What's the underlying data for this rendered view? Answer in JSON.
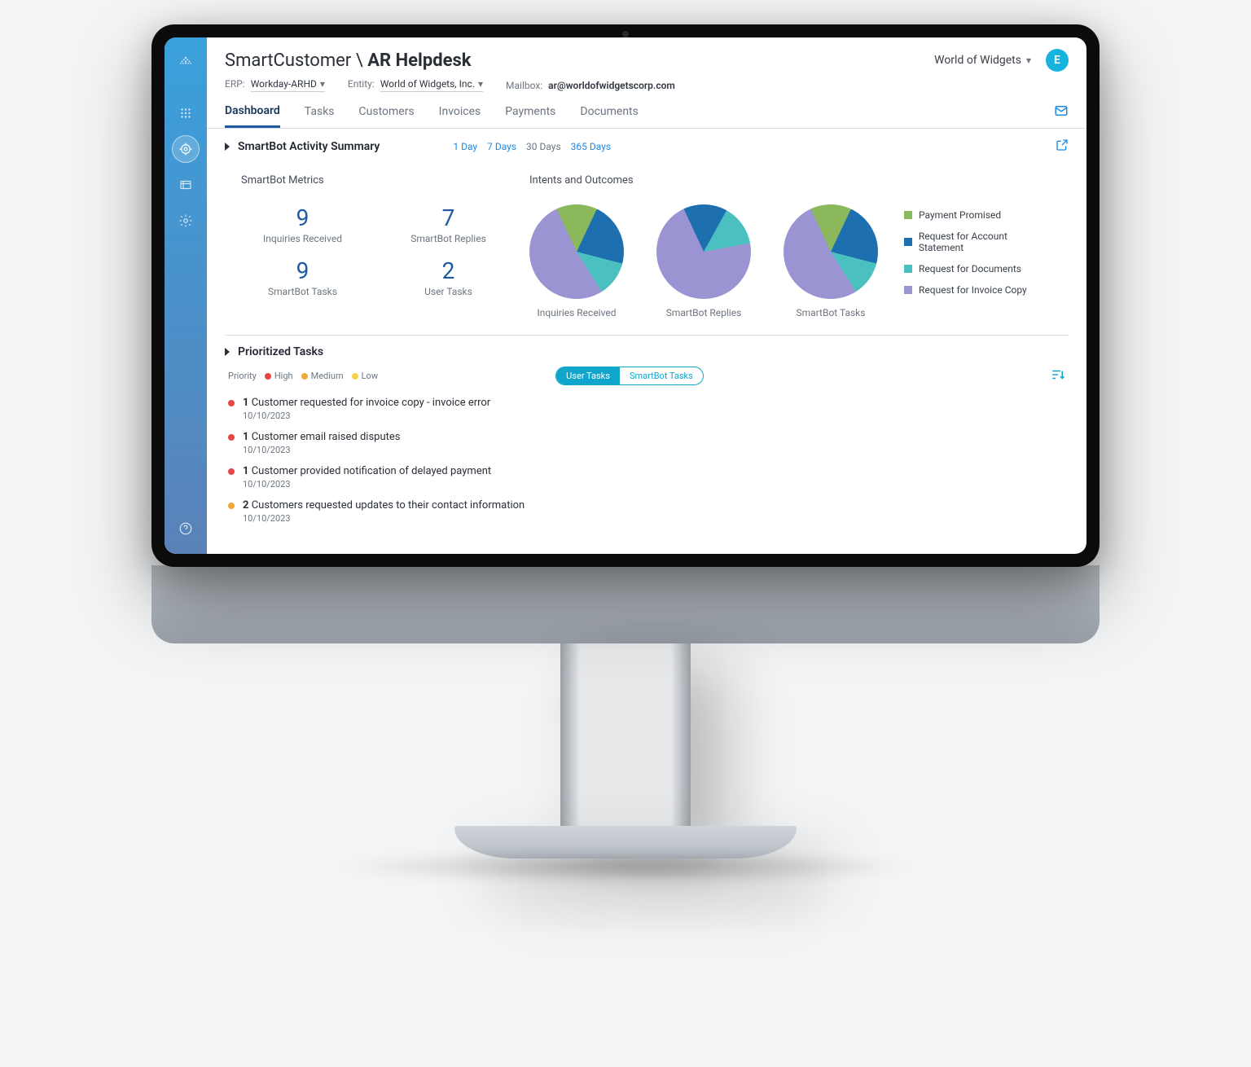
{
  "header": {
    "app_name": "SmartCustomer",
    "separator": "\\",
    "page_title": "AR Helpdesk",
    "org_name": "World of Widgets",
    "avatar_initial": "E"
  },
  "filters": {
    "erp_label": "ERP:",
    "erp_value": "Workday-ARHD",
    "entity_label": "Entity:",
    "entity_value": "World of Widgets, Inc.",
    "mailbox_label": "Mailbox:",
    "mailbox_value": "ar@worldofwidgetscorp.com"
  },
  "tabs": [
    "Dashboard",
    "Tasks",
    "Customers",
    "Invoices",
    "Payments",
    "Documents"
  ],
  "activity": {
    "title": "SmartBot Activity Summary",
    "ranges": [
      "1 Day",
      "7 Days",
      "30 Days",
      "365 Days"
    ],
    "range_links": [
      0,
      1,
      3
    ],
    "metrics_title": "SmartBot Metrics",
    "metrics": [
      {
        "value": "9",
        "label": "Inquiries Received"
      },
      {
        "value": "7",
        "label": "SmartBot Replies"
      },
      {
        "value": "9",
        "label": "SmartBot Tasks"
      },
      {
        "value": "2",
        "label": "User Tasks"
      }
    ],
    "intents_title": "Intents and Outcomes",
    "pie_labels": [
      "Inquiries Received",
      "SmartBot Replies",
      "SmartBot Tasks"
    ]
  },
  "legend": [
    {
      "label": "Payment Promised",
      "color": "#8bb85b"
    },
    {
      "label": "Request for Account Statement",
      "color": "#1e6fb0"
    },
    {
      "label": "Request for Documents",
      "color": "#4bc0c0"
    },
    {
      "label": "Request for Invoice Copy",
      "color": "#9a95d2"
    }
  ],
  "prioritized": {
    "title": "Prioritized Tasks",
    "priority_label": "Priority",
    "levels": [
      {
        "label": "High",
        "color": "#e84545"
      },
      {
        "label": "Medium",
        "color": "#f0a838"
      },
      {
        "label": "Low",
        "color": "#f6d24c"
      }
    ],
    "pills": [
      "User Tasks",
      "SmartBot Tasks"
    ],
    "tasks": [
      {
        "count": "1",
        "desc": "Customer requested for invoice copy - invoice error",
        "date": "10/10/2023",
        "dot": "#e84545"
      },
      {
        "count": "1",
        "desc": "Customer email raised disputes",
        "date": "10/10/2023",
        "dot": "#e84545"
      },
      {
        "count": "1",
        "desc": "Customer provided notification of delayed payment",
        "date": "10/10/2023",
        "dot": "#e84545"
      },
      {
        "count": "2",
        "desc": "Customers requested updates to their contact information",
        "date": "10/10/2023",
        "dot": "#f0a838"
      }
    ]
  },
  "chart_data": [
    {
      "type": "pie",
      "title": "Inquiries Received",
      "series": [
        {
          "name": "Payment Promised",
          "value": 14,
          "color": "#8bb85b"
        },
        {
          "name": "Request for Account Statement",
          "value": 22,
          "color": "#1e6fb0"
        },
        {
          "name": "Request for Documents",
          "value": 12,
          "color": "#4bc0c0"
        },
        {
          "name": "Request for Invoice Copy",
          "value": 52,
          "color": "#9a95d2"
        }
      ]
    },
    {
      "type": "pie",
      "title": "SmartBot Replies",
      "series": [
        {
          "name": "Payment Promised",
          "value": 0,
          "color": "#8bb85b"
        },
        {
          "name": "Request for Account Statement",
          "value": 15,
          "color": "#1e6fb0"
        },
        {
          "name": "Request for Documents",
          "value": 14,
          "color": "#4bc0c0"
        },
        {
          "name": "Request for Invoice Copy",
          "value": 71,
          "color": "#9a95d2"
        }
      ]
    },
    {
      "type": "pie",
      "title": "SmartBot Tasks",
      "series": [
        {
          "name": "Payment Promised",
          "value": 14,
          "color": "#8bb85b"
        },
        {
          "name": "Request for Account Statement",
          "value": 22,
          "color": "#1e6fb0"
        },
        {
          "name": "Request for Documents",
          "value": 12,
          "color": "#4bc0c0"
        },
        {
          "name": "Request for Invoice Copy",
          "value": 52,
          "color": "#9a95d2"
        }
      ]
    }
  ]
}
